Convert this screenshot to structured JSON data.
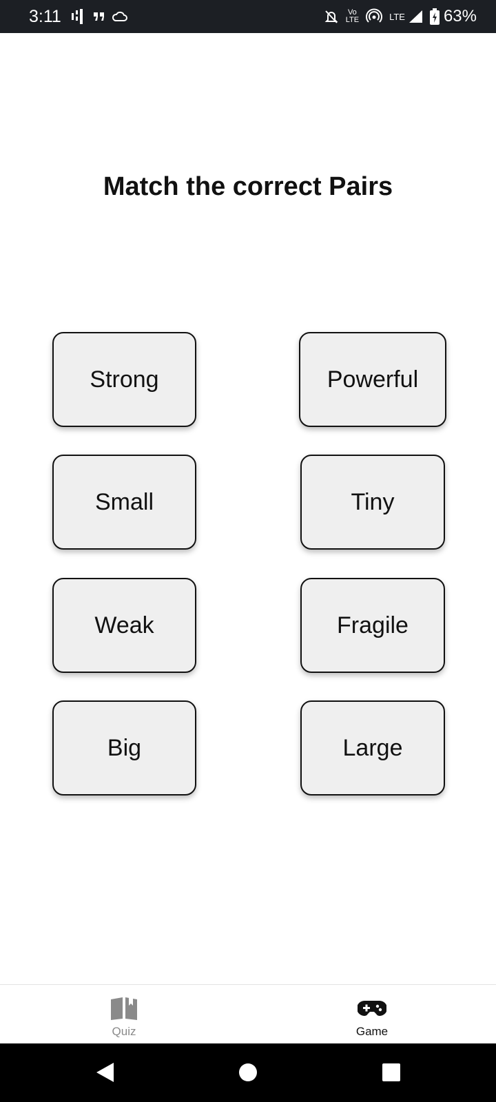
{
  "status_bar": {
    "time": "3:11",
    "vo_top": "Vo",
    "vo_bottom": "LTE",
    "network": "LTE",
    "battery": "63%",
    "icons": [
      "bars-icon",
      "quote-icon",
      "cloud-icon",
      "mute-bell-icon",
      "hotspot-icon",
      "signal-icon",
      "battery-charging-icon"
    ]
  },
  "screen": {
    "title": "Match the correct Pairs"
  },
  "cards": {
    "left": [
      "Strong",
      "Small",
      "Weak",
      "Big"
    ],
    "right": [
      "Powerful",
      "Tiny",
      "Fragile",
      "Large"
    ]
  },
  "bottom_nav": {
    "items": [
      {
        "label": "Quiz",
        "icon": "book-icon",
        "active": false
      },
      {
        "label": "Game",
        "icon": "gamepad-icon",
        "active": true
      }
    ]
  },
  "android_nav": {
    "buttons": [
      "back-icon",
      "home-icon",
      "recents-icon"
    ]
  },
  "colors": {
    "card_bg": "#efefef",
    "card_border": "#111111",
    "status_bar_bg": "#1c1f24",
    "inactive_nav": "#8a8a8a"
  }
}
